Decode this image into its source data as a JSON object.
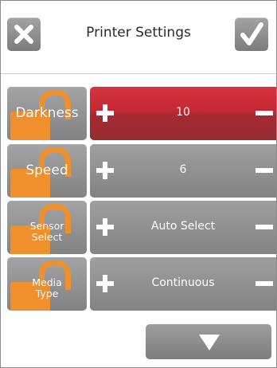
{
  "header": {
    "title": "Printer Settings",
    "cancel_icon": "close-icon",
    "confirm_icon": "check-icon"
  },
  "settings": [
    {
      "label": "Darkness",
      "value": "10",
      "active": true,
      "lock_icon": "unlock-icon"
    },
    {
      "label": "Speed",
      "value": "6",
      "active": false,
      "lock_icon": "unlock-icon"
    },
    {
      "label_line1": "Sensor",
      "label_line2": "Select",
      "value": "Auto Select",
      "active": false,
      "lock_icon": "unlock-icon"
    },
    {
      "label_line1": "Media",
      "label_line2": "Type",
      "value": "Continuous",
      "active": false,
      "lock_icon": "unlock-icon"
    }
  ],
  "controls": {
    "increase_icon": "plus-icon",
    "decrease_icon": "minus-icon",
    "scroll_down_icon": "arrow-down-icon"
  },
  "colors": {
    "active_row": "#c62831",
    "lock": "#f0902c",
    "button_gray": "#8f8f8f"
  }
}
